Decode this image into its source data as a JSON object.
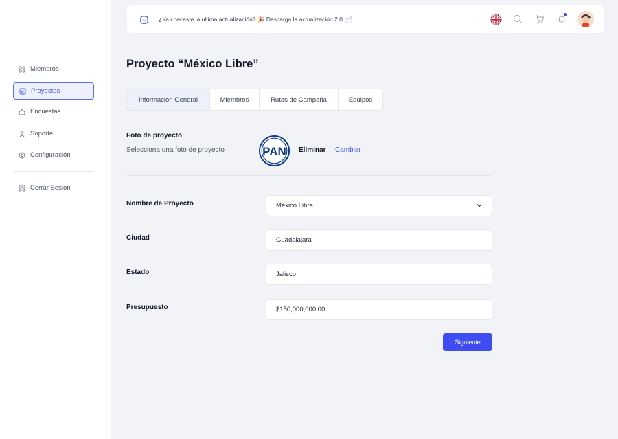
{
  "sidebar": {
    "items": [
      {
        "label": "Miembros",
        "icon": "grid-icon"
      },
      {
        "label": "Proyectos",
        "icon": "clipboard-icon",
        "active": true
      },
      {
        "label": "Encuestas",
        "icon": "home-icon"
      },
      {
        "label": "Soporte",
        "icon": "user-icon"
      },
      {
        "label": "Configuración",
        "icon": "settings-icon"
      }
    ],
    "logout": {
      "label": "Cerrar Sesión",
      "icon": "grid-icon"
    }
  },
  "topbar": {
    "announcement": "¿Ya checaste la ultima actualización? 🎉 Descarga la actualización 2.0",
    "icons": [
      "uk-flag-icon",
      "search-icon",
      "cart-icon",
      "bell-icon",
      "avatar"
    ]
  },
  "page": {
    "title": "Proyecto “México Libre”"
  },
  "tabs": [
    {
      "label": "Información General",
      "active": true
    },
    {
      "label": "Miembros"
    },
    {
      "label": "Rutas de Campaña"
    },
    {
      "label": "Equipos"
    }
  ],
  "photo": {
    "title": "Foto de proyecto",
    "subtitle": "Selecciona una foto de proyecto",
    "logo_text": "PAN",
    "delete_label": "Eliminar",
    "change_label": "Cambiar"
  },
  "form": {
    "name_label": "Nombre de Proyecto",
    "name_value": "México Libre",
    "city_label": "Ciudad",
    "city_value": "Guadalajara",
    "state_label": "Estado",
    "state_value": "Jalisco",
    "budget_label": "Presupuesto",
    "budget_value": "$150,000,000.00"
  },
  "next_button": "Siguiente",
  "colors": {
    "accent": "#3f4cf1",
    "background": "#f1f3f6",
    "pan_blue": "#0b3a8c"
  }
}
